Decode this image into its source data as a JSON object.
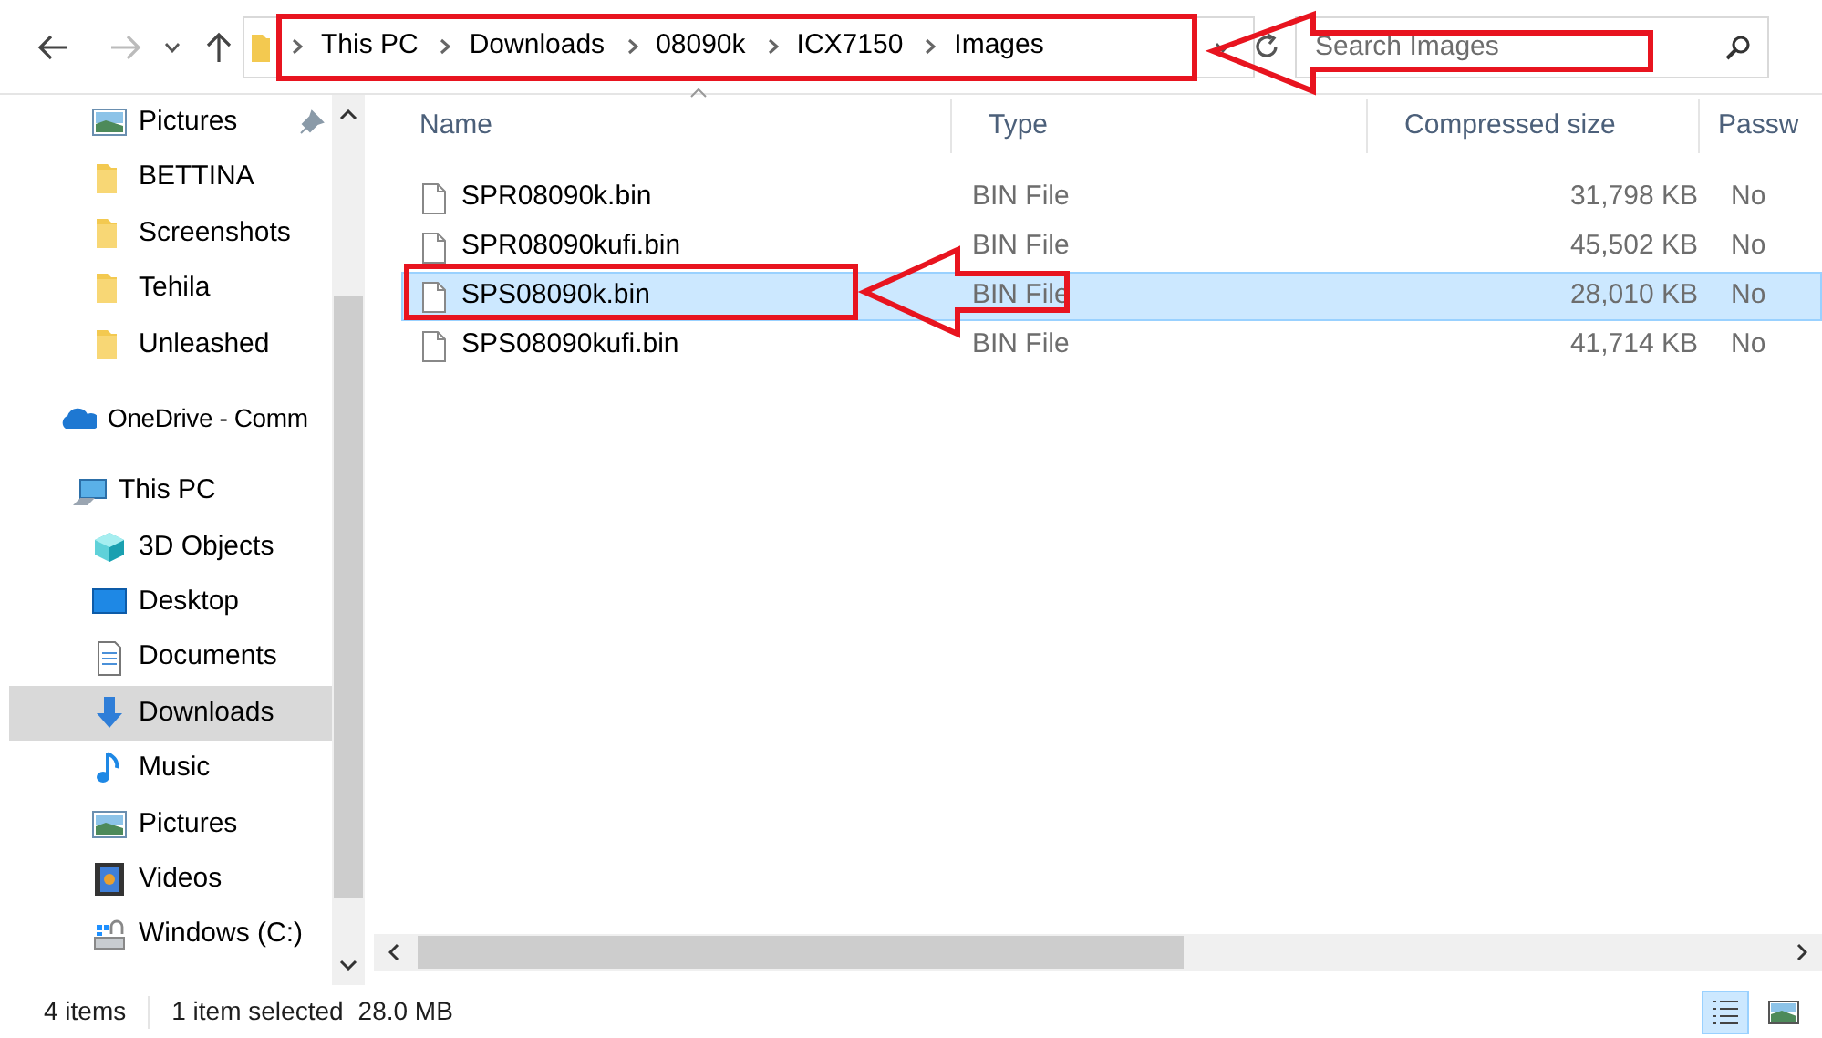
{
  "address_bar": {
    "segments": [
      "This PC",
      "Downloads",
      "08090k",
      "ICX7150",
      "Images"
    ]
  },
  "search": {
    "placeholder": "Search Images"
  },
  "sidebar": {
    "items": [
      {
        "label": "Pictures",
        "kind": "pictures",
        "pinned": true,
        "selected": false
      },
      {
        "label": "BETTINA",
        "kind": "folder",
        "pinned": false,
        "selected": false
      },
      {
        "label": "Screenshots",
        "kind": "folder",
        "pinned": false,
        "selected": false
      },
      {
        "label": "Tehila",
        "kind": "folder",
        "pinned": false,
        "selected": false
      },
      {
        "label": "Unleashed",
        "kind": "folder",
        "pinned": false,
        "selected": false
      },
      {
        "label": "OneDrive - Comm",
        "kind": "onedrive",
        "pinned": false,
        "selected": false
      },
      {
        "label": "This PC",
        "kind": "pc",
        "pinned": false,
        "selected": false
      },
      {
        "label": "3D Objects",
        "kind": "objects",
        "pinned": false,
        "selected": false
      },
      {
        "label": "Desktop",
        "kind": "desktop",
        "pinned": false,
        "selected": false
      },
      {
        "label": "Documents",
        "kind": "documents",
        "pinned": false,
        "selected": false
      },
      {
        "label": "Downloads",
        "kind": "downloads",
        "pinned": false,
        "selected": true
      },
      {
        "label": "Music",
        "kind": "music",
        "pinned": false,
        "selected": false
      },
      {
        "label": "Pictures",
        "kind": "pictures",
        "pinned": false,
        "selected": false
      },
      {
        "label": "Videos",
        "kind": "videos",
        "pinned": false,
        "selected": false
      },
      {
        "label": "Windows (C:)",
        "kind": "drive",
        "pinned": false,
        "selected": false
      }
    ]
  },
  "table": {
    "columns": [
      "Name",
      "Type",
      "Compressed size",
      "Passw"
    ],
    "rows": [
      {
        "name": "SPR08090k.bin",
        "type": "BIN File",
        "size": "31,798 KB",
        "column_4": "No",
        "selected": false
      },
      {
        "name": "SPR08090kufi.bin",
        "type": "BIN File",
        "size": "45,502 KB",
        "column_4": "No",
        "selected": false
      },
      {
        "name": "SPS08090k.bin",
        "type": "BIN File",
        "size": "28,010 KB",
        "column_4": "No",
        "selected": true
      },
      {
        "name": "SPS08090kufi.bin",
        "type": "BIN File",
        "size": "41,714 KB",
        "column_4": "No",
        "selected": false
      }
    ]
  },
  "status_bar": {
    "item_count": "4 items",
    "selection": "1 item selected",
    "size": "28.0 MB"
  },
  "view_buttons": [
    {
      "kind": "details",
      "selected": true
    },
    {
      "kind": "large_icons",
      "selected": false
    }
  ]
}
